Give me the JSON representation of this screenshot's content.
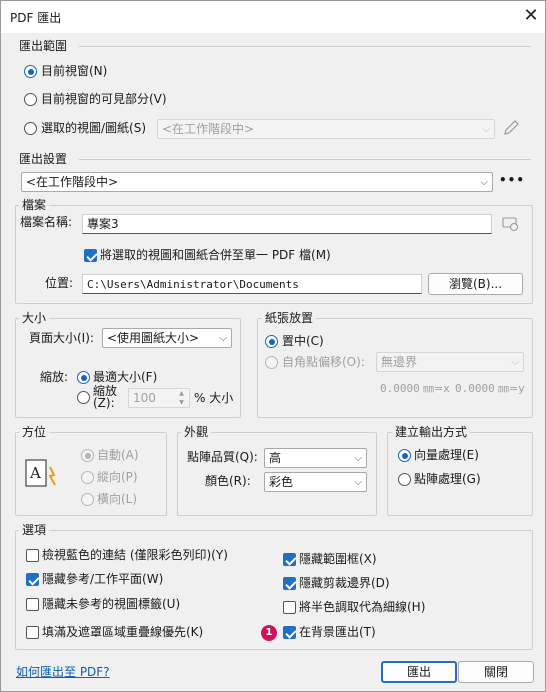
{
  "window": {
    "title": "PDF 匯出",
    "close": "✕"
  },
  "export_range": {
    "header": "匯出範圍",
    "options": [
      "目前視窗(N)",
      "目前視窗的可見部分(V)",
      "選取的視圖/圖紙(S)"
    ],
    "selected_index": 0,
    "layout_combo": "<在工作階段中>"
  },
  "export_settings": {
    "header": "匯出設置",
    "combo": "<在工作階段中>",
    "more": "•••"
  },
  "file": {
    "group_label": "檔案",
    "name_label": "檔案名稱:",
    "name_value": "專案3",
    "combine_label": "將選取的視圖和圖紙合併至單一 PDF 檔(M)",
    "combine_checked": true,
    "location_label": "位置:",
    "location_value": "C:\\Users\\Administrator\\Documents",
    "browse_label": "瀏覽(B)..."
  },
  "size": {
    "group_label": "大小",
    "page_size_label": "頁面大小(I):",
    "page_size_value": "<使用圖紙大小>",
    "zoom_label": "縮放:",
    "fit_label": "最適大小(F)",
    "zoom_option_label": "縮放\n(Z):",
    "zoom_value": "100",
    "zoom_unit": "% 大小",
    "selected": "fit"
  },
  "paper_placement": {
    "group_label": "紙張放置",
    "center_label": "置中(C)",
    "offset_label": "自角點偏移(O):",
    "offset_combo": "無邊界",
    "x_value": "0.0000",
    "x_unit": "㎜=x",
    "y_value": "0.0000",
    "y_unit": "㎜=y",
    "selected": "center"
  },
  "orientation": {
    "group_label": "方位",
    "options": [
      "自動(A)",
      "縱向(P)",
      "橫向(L)"
    ],
    "selected_index": 0
  },
  "appearance": {
    "group_label": "外觀",
    "raster_quality_label": "點陣品質(Q):",
    "raster_quality_value": "高",
    "color_label": "顏色(R):",
    "color_value": "彩色"
  },
  "output_method": {
    "group_label": "建立輸出方式",
    "options": [
      "向量處理(E)",
      "點陣處理(G)"
    ],
    "selected_index": 0
  },
  "options": {
    "header": "選項",
    "left": [
      {
        "label": "檢視藍色的連結 (僅限彩色列印)(Y)",
        "checked": false
      },
      {
        "label": "隱藏參考/工作平面(W)",
        "checked": true
      },
      {
        "label": "隱藏未參考的視圖標籤(U)",
        "checked": false
      },
      {
        "label": "填滿及遮罩區域重疊線優先(K)",
        "checked": false
      }
    ],
    "right": [
      {
        "label": "隱藏範圍框(X)",
        "checked": true
      },
      {
        "label": "隱藏剪裁邊界(D)",
        "checked": true
      },
      {
        "label": "將半色調取代為細線(H)",
        "checked": false
      },
      {
        "label": "在背景匯出(T)",
        "checked": true
      }
    ],
    "badge": "1"
  },
  "footer": {
    "help_link": "如何匯出至 PDF?",
    "export_button": "匯出",
    "close_button": "關閉"
  },
  "colors": {
    "accent": "#1f6fc5",
    "badge": "#d0105f"
  }
}
